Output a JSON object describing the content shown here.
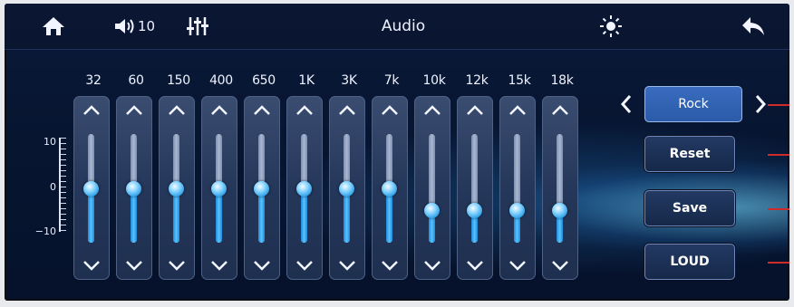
{
  "topbar": {
    "volume_level": "10",
    "title": "Audio"
  },
  "scale": {
    "top": "10",
    "mid": "0",
    "bottom": "−10"
  },
  "equalizer": {
    "bands": [
      {
        "freq": "32",
        "level": 0
      },
      {
        "freq": "60",
        "level": 0
      },
      {
        "freq": "150",
        "level": 0
      },
      {
        "freq": "400",
        "level": 0
      },
      {
        "freq": "650",
        "level": 0
      },
      {
        "freq": "1K",
        "level": 0
      },
      {
        "freq": "3K",
        "level": 0
      },
      {
        "freq": "7k",
        "level": 0
      },
      {
        "freq": "10k",
        "level": -4
      },
      {
        "freq": "12k",
        "level": -4
      },
      {
        "freq": "15k",
        "level": -4
      },
      {
        "freq": "18k",
        "level": -4
      }
    ],
    "range": [
      -10,
      10
    ]
  },
  "controls": {
    "preset": "Rock",
    "reset": "Reset",
    "save": "Save",
    "loud": "LOUD"
  },
  "colors": {
    "accent": "#3aa8f0",
    "background": "#071531"
  }
}
